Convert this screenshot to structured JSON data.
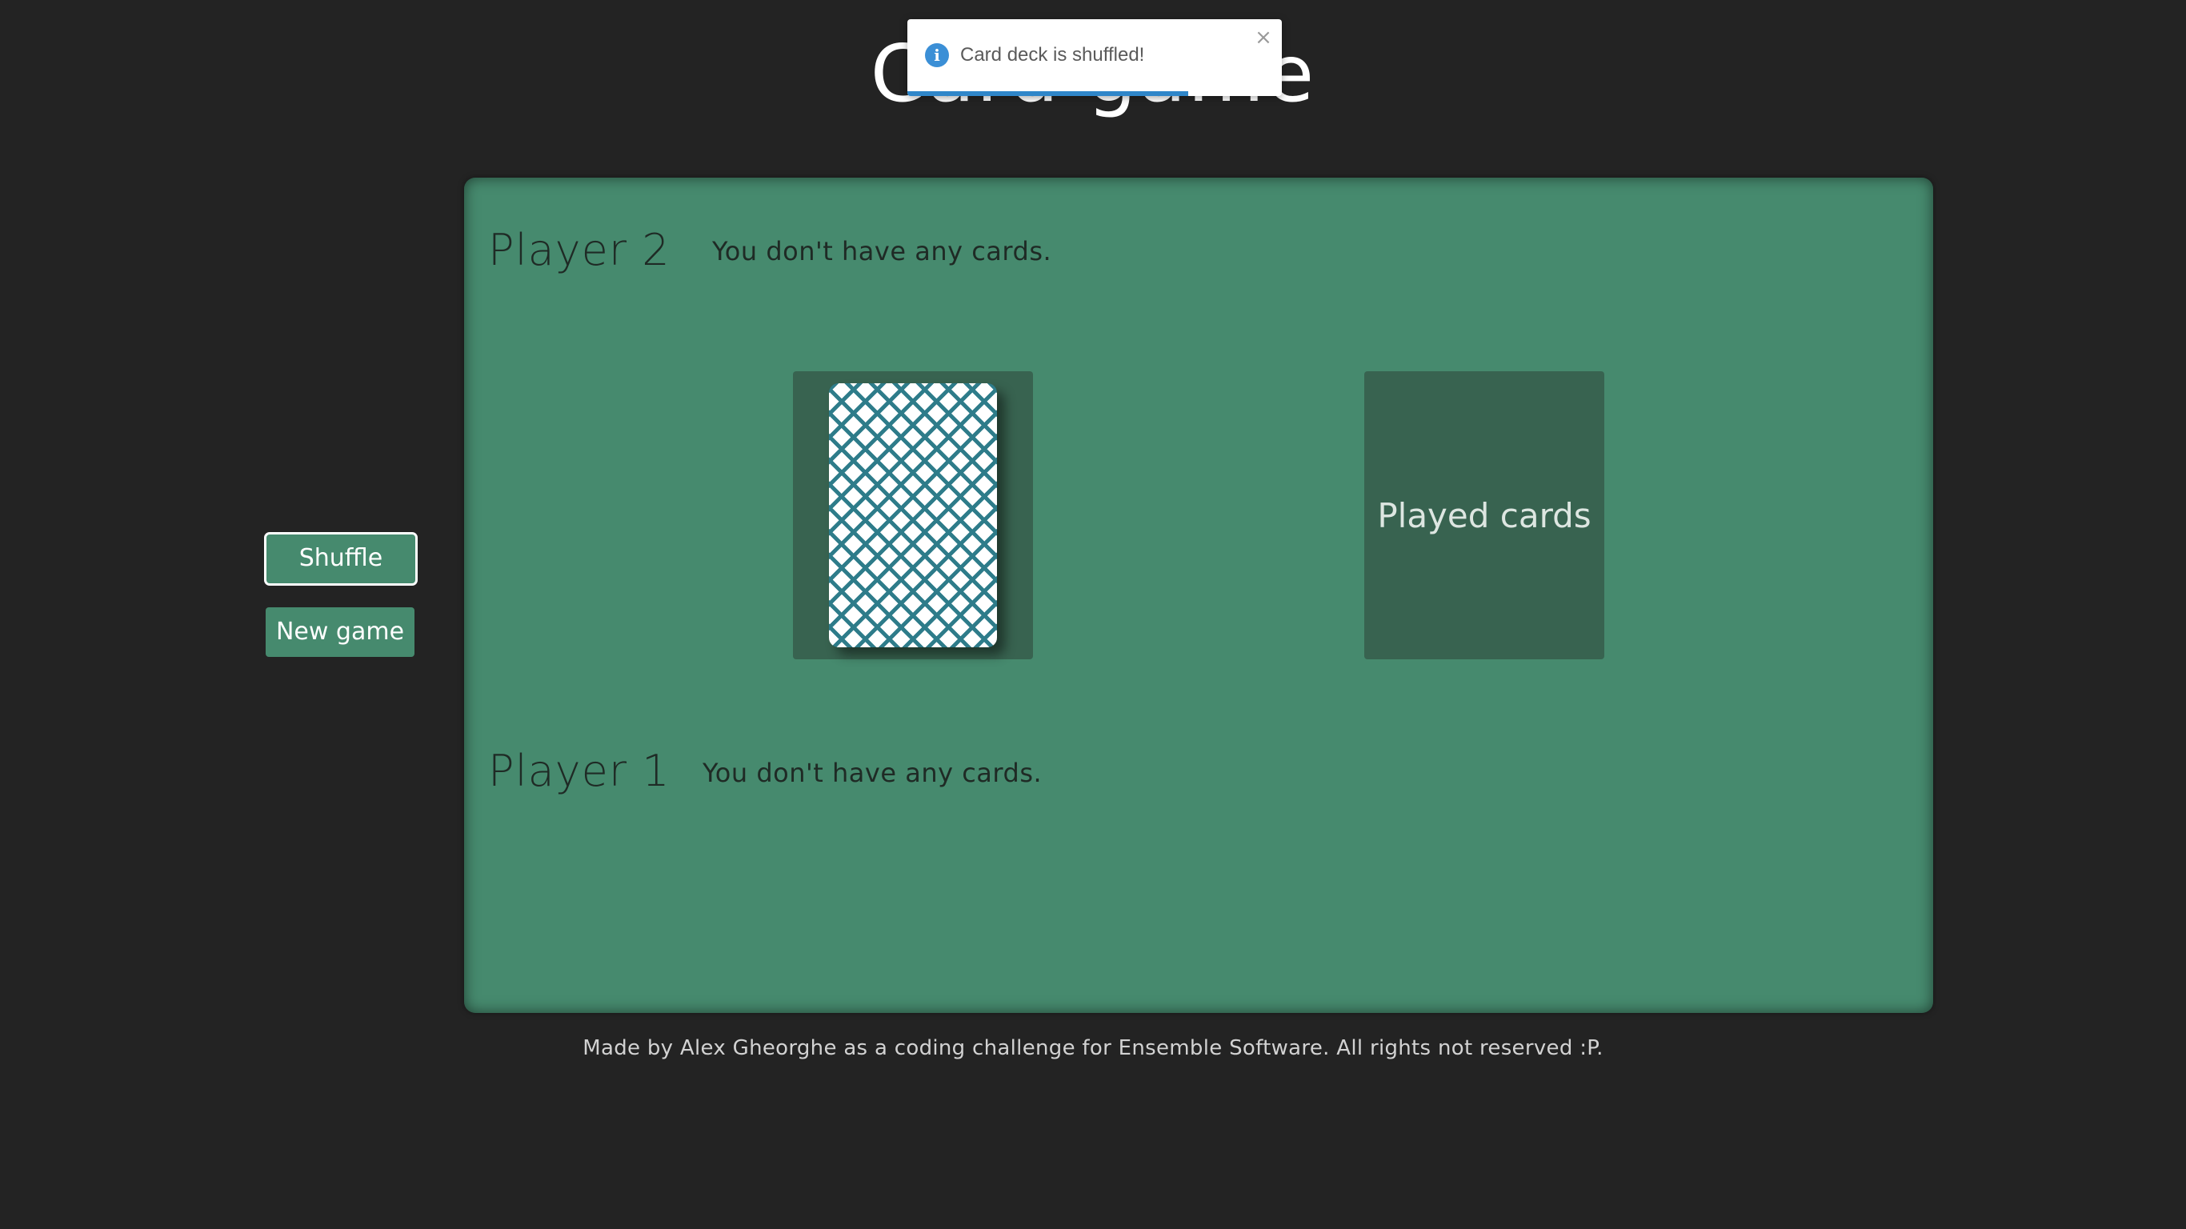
{
  "page": {
    "title": "Card game",
    "footer": "Made by Alex Gheorghe as a coding challenge for Ensemble Software. All rights not reserved :P."
  },
  "toast": {
    "icon": "info-icon",
    "icon_glyph": "i",
    "message": "Card deck is shuffled!",
    "close_glyph": "×",
    "progress_fraction": 0.75
  },
  "controls": {
    "shuffle_label": "Shuffle",
    "new_game_label": "New game"
  },
  "players": [
    {
      "name": "Player 2",
      "status": "You don't have any cards."
    },
    {
      "name": "Player 1",
      "status": "You don't have any cards."
    }
  ],
  "deck": {
    "icon": "card-back-icon"
  },
  "played_pile": {
    "label": "Played cards"
  },
  "colors": {
    "background": "#232323",
    "table_green": "#468a6e",
    "slot_green": "#386350",
    "card_pattern": "#2e7c8a",
    "toast_accent": "#2f86c9"
  }
}
